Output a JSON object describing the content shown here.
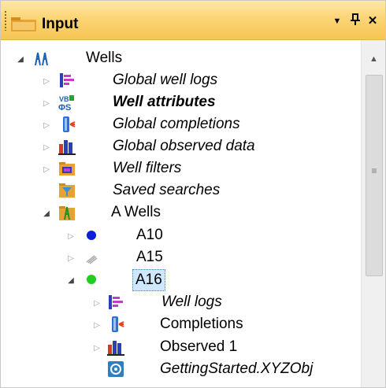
{
  "panel": {
    "title": "Input",
    "dropdown_glyph": "▼",
    "pin_glyph": "✈",
    "close_glyph": "✕"
  },
  "scrollbar": {
    "up_glyph": "▲",
    "grip_glyph": "≡"
  },
  "tree": {
    "root": {
      "label": "Wells",
      "icon": "wells-icon"
    },
    "items": [
      {
        "label": "Global well logs",
        "icon": "well-logs-icon"
      },
      {
        "label": "Well attributes",
        "icon": "well-attributes-icon"
      },
      {
        "label": "Global completions",
        "icon": "completions-icon"
      },
      {
        "label": "Global observed data",
        "icon": "observed-data-icon"
      },
      {
        "label": "Well filters",
        "icon": "well-filters-icon"
      },
      {
        "label": "Saved searches",
        "icon": "saved-searches-icon"
      },
      {
        "label": "A Wells",
        "icon": "well-folder-icon"
      },
      {
        "label": "A10",
        "icon": "blue-dot-icon"
      },
      {
        "label": "A15",
        "icon": "gray-well-icon"
      },
      {
        "label": "A16",
        "icon": "green-dot-icon"
      },
      {
        "label": "Well logs",
        "icon": "well-logs-icon"
      },
      {
        "label": "Completions",
        "icon": "completions-icon"
      },
      {
        "label": "Observed 1",
        "icon": "observed-data-icon"
      },
      {
        "label": "GettingStarted.XYZObj",
        "icon": "xyz-object-icon"
      }
    ]
  },
  "colors": {
    "title_bar": "#f9cf64",
    "selection": "#cde8ff",
    "blue_dot": "#0a1fd6",
    "green_dot": "#22cc22"
  }
}
